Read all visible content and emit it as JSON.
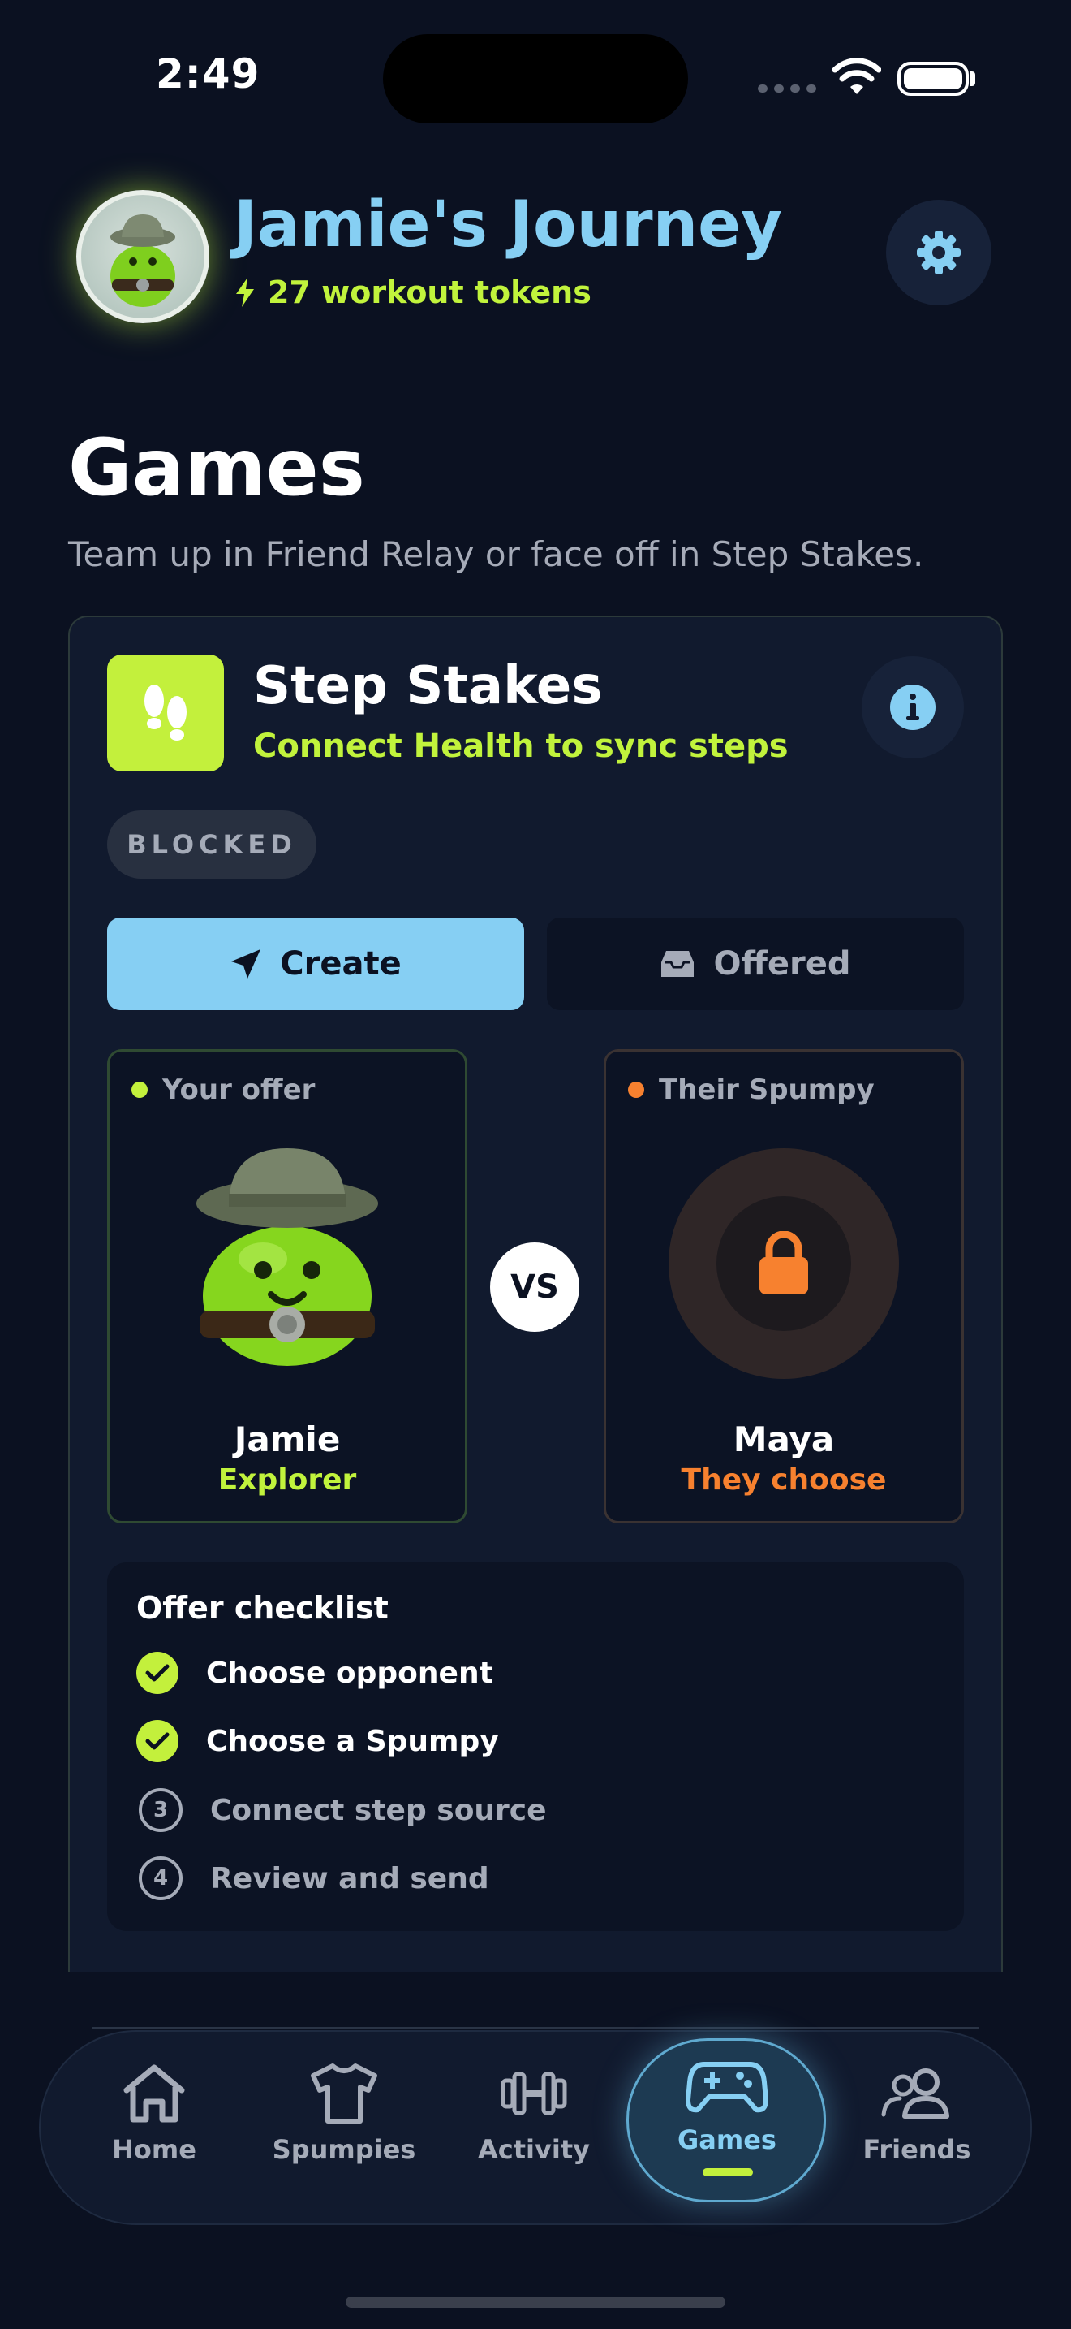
{
  "status_bar": {
    "time": "2:49"
  },
  "header": {
    "title": "Jamie's Journey",
    "tokens": "27 workout tokens"
  },
  "page": {
    "title": "Games",
    "subtitle": "Team up in Friend Relay or face off in Step Stakes."
  },
  "game": {
    "title": "Step Stakes",
    "subtitle": "Connect Health to sync steps",
    "status_badge": "BLOCKED",
    "tabs": [
      {
        "label": "Create",
        "icon": "paper-plane-icon",
        "active": true
      },
      {
        "label": "Offered",
        "icon": "inbox-icon",
        "active": false
      }
    ],
    "your_offer": {
      "label": "Your offer",
      "name": "Jamie",
      "role": "Explorer",
      "dot_color": "#c3f03c"
    },
    "versus": "VS",
    "their_spumpy": {
      "label": "Their Spumpy",
      "name": "Maya",
      "role": "They choose",
      "dot_color": "#f7812f"
    },
    "checklist": {
      "title": "Offer checklist",
      "items": [
        {
          "label": "Choose opponent",
          "state": "done"
        },
        {
          "label": "Choose a Spumpy",
          "state": "done"
        },
        {
          "label": "Connect step source",
          "state": "todo",
          "number": "3"
        },
        {
          "label": "Review and send",
          "state": "todo",
          "number": "4"
        }
      ]
    }
  },
  "nav": {
    "items": [
      {
        "label": "Home",
        "icon": "home-icon"
      },
      {
        "label": "Spumpies",
        "icon": "shirt-icon"
      },
      {
        "label": "Activity",
        "icon": "dumbbell-icon"
      },
      {
        "label": "Games",
        "icon": "gamepad-icon",
        "active": true
      },
      {
        "label": "Friends",
        "icon": "friends-icon"
      }
    ]
  },
  "colors": {
    "background": "#0b1121",
    "accent_lime": "#c1f33c",
    "accent_blue": "#86cff3",
    "accent_orange": "#f7812f"
  }
}
